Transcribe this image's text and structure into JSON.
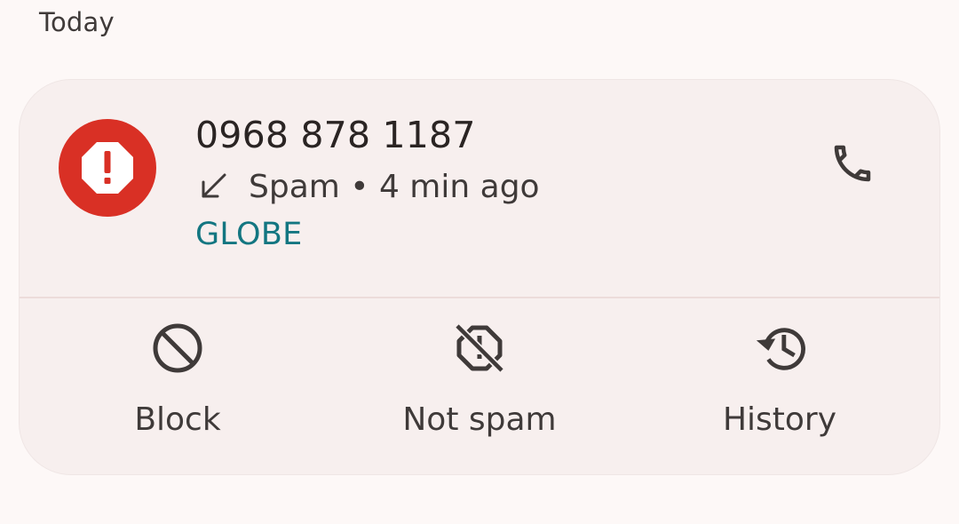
{
  "section": {
    "title": "Today"
  },
  "call_entry": {
    "number": "0968 878 1187",
    "direction_icon": "incoming-call-arrow-icon",
    "status": "Spam • 4 min ago",
    "carrier": "GLOBE",
    "avatar_icon": "spam-warning-icon",
    "call_icon": "phone-icon",
    "accent_color": "#d93025",
    "carrier_color": "#137681"
  },
  "actions": [
    {
      "label": "Block",
      "icon": "block-icon"
    },
    {
      "label": "Not spam",
      "icon": "not-spam-icon"
    },
    {
      "label": "History",
      "icon": "history-icon"
    }
  ]
}
